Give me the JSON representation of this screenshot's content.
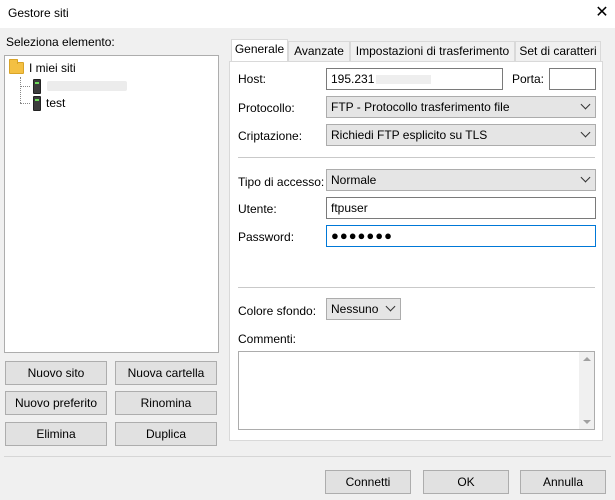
{
  "window": {
    "title": "Gestore siti",
    "close_glyph": "✕"
  },
  "tree": {
    "label": "Seleziona elemento:",
    "root": "I miei siti",
    "items": [
      {
        "name": "",
        "icon": "server-icon"
      },
      {
        "name": "test",
        "icon": "server-icon"
      }
    ]
  },
  "left_buttons": {
    "new_site": "Nuovo sito",
    "new_folder": "Nuova cartella",
    "new_bookmark": "Nuovo preferito",
    "rename": "Rinomina",
    "delete": "Elimina",
    "duplicate": "Duplica"
  },
  "tabs": [
    {
      "label": "Generale",
      "active": true
    },
    {
      "label": "Avanzate",
      "active": false
    },
    {
      "label": "Impostazioni di trasferimento",
      "active": false
    },
    {
      "label": "Set di caratteri",
      "active": false
    }
  ],
  "general": {
    "host_label": "Host:",
    "host_value": "195.231",
    "port_label": "Porta:",
    "port_value": "",
    "protocol_label": "Protocollo:",
    "protocol_value": "FTP - Protocollo trasferimento file",
    "encryption_label": "Criptazione:",
    "encryption_value": "Richiedi FTP esplicito su TLS",
    "logon_label": "Tipo di accesso:",
    "logon_value": "Normale",
    "user_label": "Utente:",
    "user_value": "ftpuser",
    "password_label": "Password:",
    "password_value": "●●●●●●●",
    "bg_color_label": "Colore sfondo:",
    "bg_color_value": "Nessuno",
    "comments_label": "Commenti:",
    "comments_value": ""
  },
  "footer": {
    "connect": "Connetti",
    "ok": "OK",
    "cancel": "Annulla"
  },
  "colors": {
    "window_bg": "#f0f0f0",
    "focus_border": "#0078d7",
    "folder": "#f4c042"
  }
}
